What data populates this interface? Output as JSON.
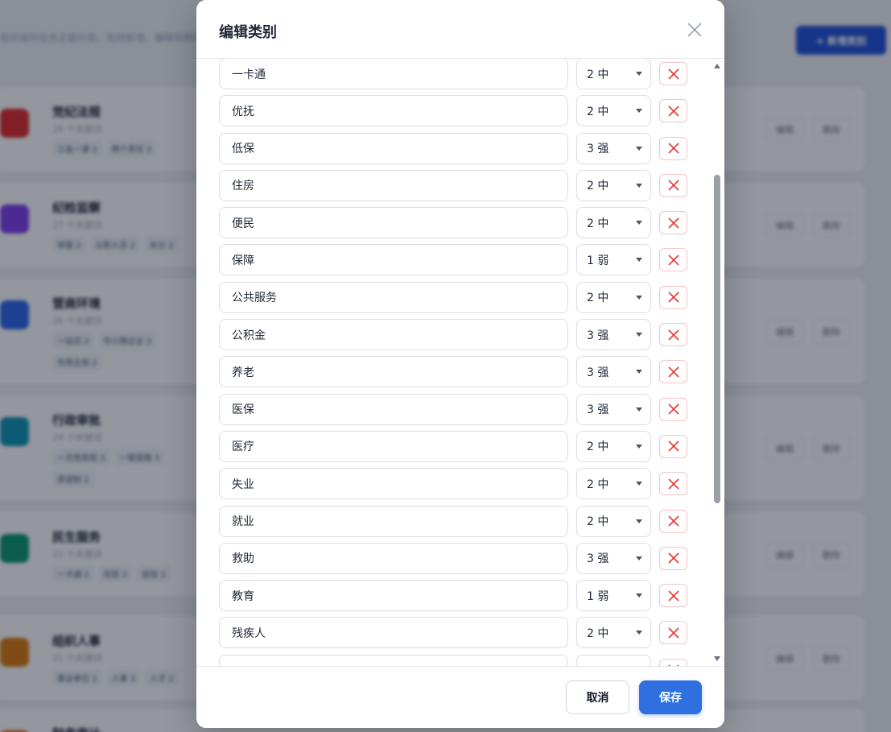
{
  "background": {
    "subtitle": "知识库的业务主题分类，支持新增、编辑和删除",
    "add_button": "+ 新增类别",
    "edit_label": "编辑",
    "delete_label": "删除",
    "cards": [
      {
        "title": "党纪法规",
        "count": "28 个关键词",
        "tags": [
          "三会一课 2",
          "两个责任 3"
        ],
        "color": "#dc2626"
      },
      {
        "title": "纪检监察",
        "count": "27 个关键词",
        "tags": [
          "举报 2",
          "公职人员 2",
          "处分 2"
        ],
        "color": "#7c3aed"
      },
      {
        "title": "营商环境",
        "count": "26 个关键词",
        "tags": [
          "一站式 2",
          "中小微企业 3",
          "市场主体 2"
        ],
        "color": "#2563eb"
      },
      {
        "title": "行政审批",
        "count": "24 个关键词",
        "tags": [
          "一次性告知 3",
          "一窗受理 3",
          "承诺制 2"
        ],
        "color": "#0891b2"
      },
      {
        "title": "民生服务",
        "count": "22 个关键词",
        "tags": [
          "一卡通 2",
          "优抚 2",
          "低保 3"
        ],
        "color": "#059669"
      },
      {
        "title": "组织人事",
        "count": "21 个关键词",
        "tags": [
          "事业单位 2",
          "人事 3",
          "人才 2"
        ],
        "color": "#d97706"
      },
      {
        "title": "财务审计",
        "count": "",
        "tags": [],
        "color": "#ea580c"
      }
    ]
  },
  "modal": {
    "title": "编辑类别",
    "cancel_label": "取消",
    "save_label": "保存",
    "accent_color": "#2f6fe0",
    "delete_color": "#e53935",
    "rows": [
      {
        "name": "一卡通",
        "level": "2 中"
      },
      {
        "name": "优抚",
        "level": "2 中"
      },
      {
        "name": "低保",
        "level": "3 强"
      },
      {
        "name": "住房",
        "level": "2 中"
      },
      {
        "name": "便民",
        "level": "2 中"
      },
      {
        "name": "保障",
        "level": "1 弱"
      },
      {
        "name": "公共服务",
        "level": "2 中"
      },
      {
        "name": "公积金",
        "level": "3 强"
      },
      {
        "name": "养老",
        "level": "3 强"
      },
      {
        "name": "医保",
        "level": "3 强"
      },
      {
        "name": "医疗",
        "level": "2 中"
      },
      {
        "name": "失业",
        "level": "2 中"
      },
      {
        "name": "就业",
        "level": "2 中"
      },
      {
        "name": "救助",
        "level": "3 强"
      },
      {
        "name": "教育",
        "level": "1 弱"
      },
      {
        "name": "残疾人",
        "level": "2 中"
      },
      {
        "name": "",
        "level": ""
      }
    ]
  }
}
